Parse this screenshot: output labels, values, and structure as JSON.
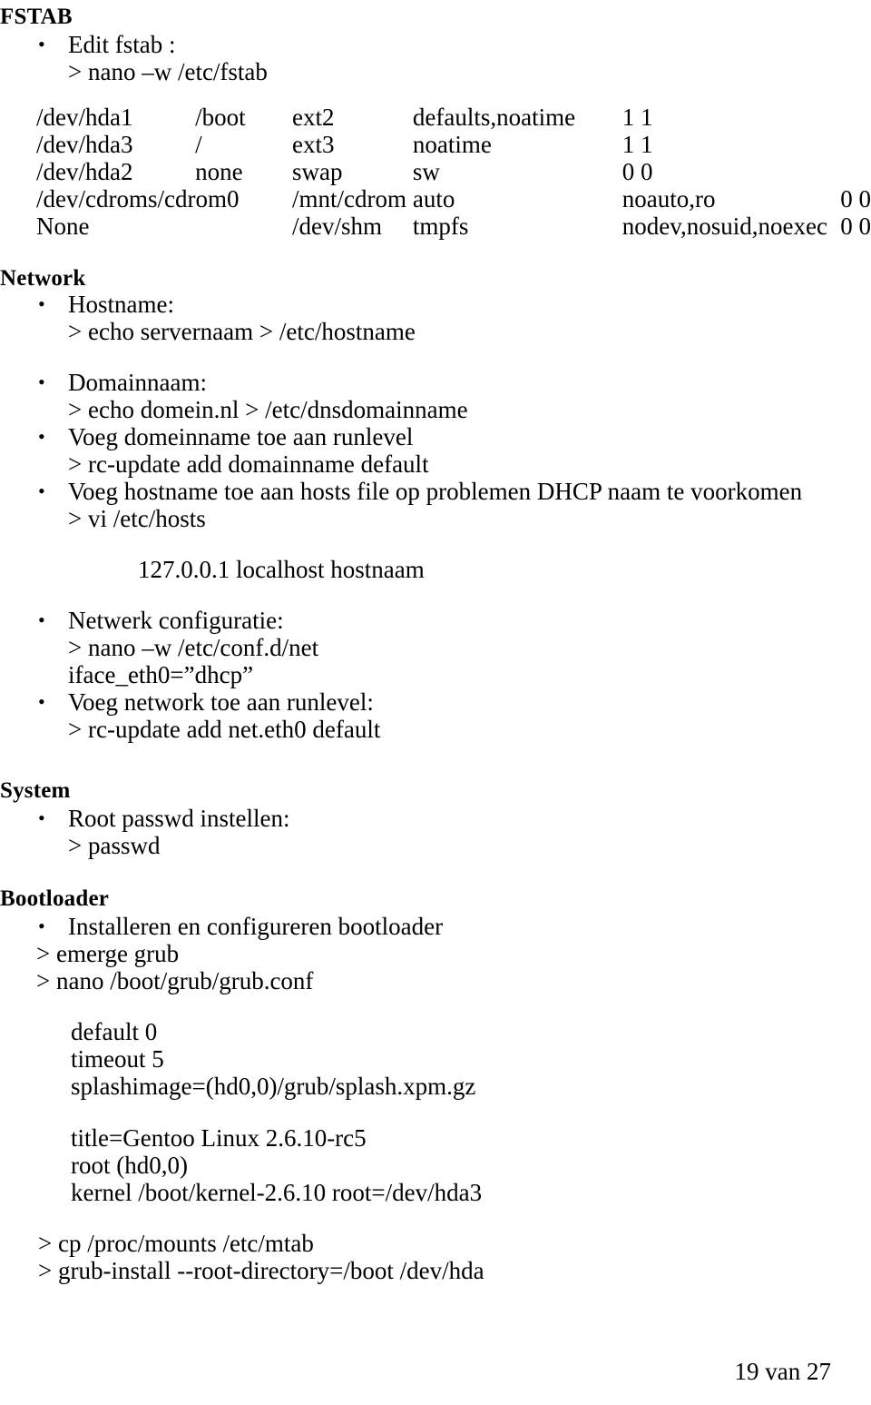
{
  "document": {
    "bullet_glyph": "•"
  },
  "fstab": {
    "heading": "FSTAB",
    "bullets": [
      {
        "label": "Edit fstab :",
        "command": "> nano –w /etc/fstab"
      }
    ],
    "table": {
      "columns": [
        "device",
        "mountpoint",
        "type",
        "options",
        "dump_pass"
      ],
      "rows": [
        {
          "device": "/dev/hda1",
          "mountpoint": "/boot",
          "type": "ext2",
          "options": "defaults,noatime",
          "dump_pass": "1 1",
          "wide": false
        },
        {
          "device": "/dev/hda3",
          "mountpoint": "/",
          "type": "ext3",
          "options": "noatime",
          "dump_pass": "1 1",
          "wide": false
        },
        {
          "device": "/dev/hda2",
          "mountpoint": "none",
          "type": "swap",
          "options": "sw",
          "dump_pass": "0 0",
          "wide": false
        },
        {
          "device": "/dev/cdroms/cdrom0",
          "mountpoint": "/mnt/cdrom",
          "type": "auto",
          "options": "noauto,ro",
          "dump_pass": "0 0",
          "wide": true
        },
        {
          "device": "None",
          "mountpoint": "/dev/shm",
          "type": "tmpfs",
          "options": "nodev,nosuid,noexec",
          "dump_pass": "0 0",
          "wide": true
        }
      ]
    }
  },
  "network": {
    "heading": "Network",
    "hostname_bullet": "Hostname:",
    "hostname_command": "> echo servernaam > /etc/hostname",
    "domain_bullet": "Domainnaam:",
    "domain_command": "> echo domein.nl > /etc/dnsdomainname",
    "runlevel_bullet": "Voeg domeinname toe aan runlevel",
    "runlevel_command": "> rc-update add domainname default",
    "hosts_bullet": "Voeg hostname toe aan hosts file op problemen DHCP naam te voorkomen",
    "hosts_command": "> vi /etc/hosts",
    "hosts_entry": "127.0.0.1 localhost hostnaam",
    "netconf_bullet": "Netwerk configuratie:",
    "netconf_command": "> nano –w /etc/conf.d/net",
    "netconf_value": "iface_eth0=”dhcp”",
    "netrunlevel_bullet": "Voeg network toe aan runlevel:",
    "netrunlevel_command": "> rc-update add net.eth0 default"
  },
  "system": {
    "heading": "System",
    "passwd_bullet": "Root passwd instellen:",
    "passwd_command": "> passwd"
  },
  "bootloader": {
    "heading": "Bootloader",
    "install_bullet": "Installeren en configureren bootloader",
    "emerge_command": "> emerge grub",
    "nano_command": "> nano /boot/grub/grub.conf",
    "grub_conf_block_1": [
      "default 0",
      "timeout 5",
      "splashimage=(hd0,0)/grub/splash.xpm.gz"
    ],
    "grub_conf_block_2": [
      "title=Gentoo Linux 2.6.10-rc5",
      "root (hd0,0)",
      "kernel /boot/kernel-2.6.10 root=/dev/hda3"
    ],
    "mtab_command": "> cp /proc/mounts /etc/mtab",
    "grub_install_command": "> grub-install --root-directory=/boot /dev/hda"
  },
  "footer": {
    "page_indicator": "19 van 27"
  }
}
